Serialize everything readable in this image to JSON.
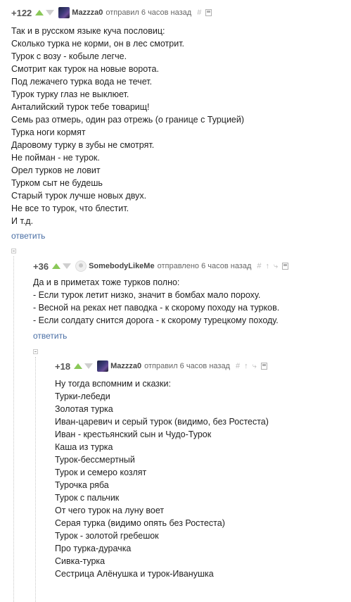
{
  "comments": [
    {
      "rating": "+122",
      "author": "Mazzza0",
      "meta": "отправил 6 часов назад",
      "lines": [
        "Так и в русском языке куча пословиц:",
        "Сколько турка не корми, он в лес смотрит.",
        "Турок с возу - кобыле легче.",
        "Смотрит как турок на новые ворота.",
        "Под лежачего турка вода не течет.",
        "Турок турку глаз не выклюет.",
        "Анталийский турок тебе товарищ!",
        "Семь раз отмерь, один раз отрежь (о границе с Турцией)",
        "Турка ноги кормят",
        "Даровому турку в зубы не смотрят.",
        "Не пойман - не турок.",
        "Орел турков не ловит",
        "Турком сыт не будешь",
        "Старый турок лучше новых двух.",
        "Не все то турок, что блестит.",
        "И т.д."
      ],
      "reply": "ответить"
    },
    {
      "rating": "+36",
      "author": "SomebodyLikeMe",
      "meta": "отправлено 6 часов назад",
      "lines": [
        "Да и в приметах тоже турков полно:",
        "- Если турок летит низко, значит в бомбах мало пороху.",
        "- Весной на реках нет паводка - к скорому походу на турков.",
        "- Если солдату снится дорога - к скорому турецкому походу."
      ],
      "reply": "ответить"
    },
    {
      "rating": "+18",
      "author": "Mazzza0",
      "meta": "отправил 6 часов назад",
      "lines": [
        "Ну тогда вспомним и сказки:",
        "Турки-лебеди",
        "Золотая турка",
        "Иван-царевич и серый турок (видимо, без Ростеста)",
        "Иван - крестьянский сын и Чудо-Турок",
        "Каша из турка",
        "Турок-бессмертный",
        "Турок и семеро козлят",
        "Турочка ряба",
        "Турок с пальчик",
        "От чего турок на луну воет",
        "Серая турка (видимо опять без Ростеста)",
        "Турок - золотой гребешок",
        "Про турка-дурачка",
        "Сивка-турка",
        "Сестрица Алёнушка и турок-Иванушка"
      ]
    }
  ],
  "icons": {
    "link": "#",
    "parent": "↑",
    "thread": "⤷",
    "save": "save-icon"
  }
}
